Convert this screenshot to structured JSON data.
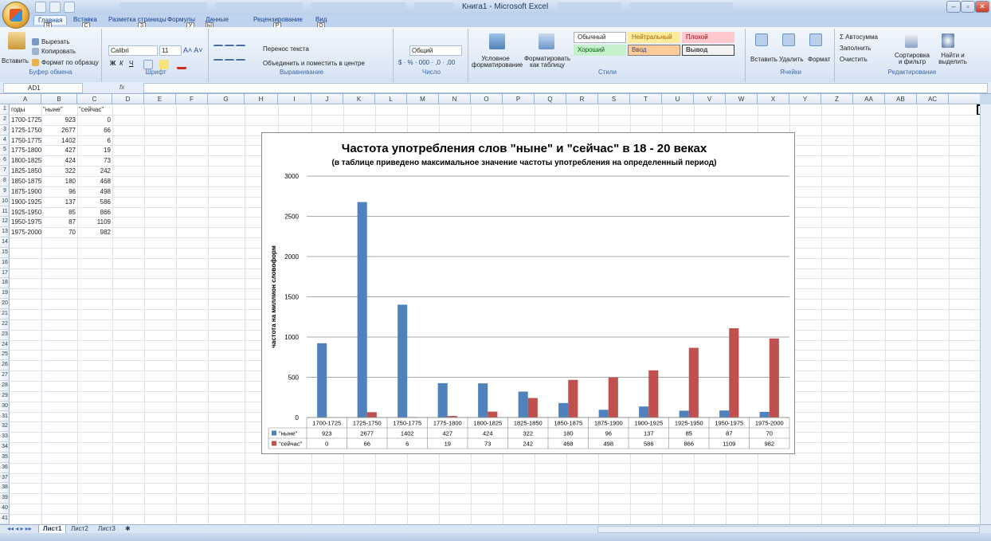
{
  "window": {
    "title": "Книга1 - Microsoft Excel",
    "controls": [
      "–",
      "▫",
      "✕"
    ]
  },
  "ribbon": {
    "tabs": [
      "Главная",
      "Вставка",
      "Разметка страницы",
      "Формулы",
      "Данные",
      "Рецензирование",
      "Вид"
    ],
    "keytips": [
      "Я",
      "С",
      "З",
      "У",
      "Ы",
      "Р",
      "О"
    ],
    "clipboard": {
      "paste": "Вставить",
      "cut": "Вырезать",
      "copy": "Копировать",
      "format_painter": "Формат по образцу",
      "label": "Буфер обмена"
    },
    "font": {
      "name": "Calibri",
      "size": "11",
      "bold": "Ж",
      "italic": "К",
      "underline": "Ч",
      "label": "Шрифт"
    },
    "alignment": {
      "wrap": "Перенос текста",
      "merge": "Объединить и поместить в центре",
      "label": "Выравнивание"
    },
    "number": {
      "format": "Общий",
      "label": "Число"
    },
    "styles": {
      "conditional": "Условное форматирование",
      "as_table": "Форматировать как таблицу",
      "normal": "Обычный",
      "neutral": "Нейтральный",
      "bad": "Плохой",
      "good": "Хороший",
      "input": "Ввод",
      "output": "Вывод",
      "label": "Стили"
    },
    "cells": {
      "insert": "Вставить",
      "delete": "Удалить",
      "format": "Формат",
      "label": "Ячейки"
    },
    "editing": {
      "autosum": "Автосумма",
      "fill": "Заполнить",
      "clear": "Очистить",
      "sort": "Сортировка и фильтр",
      "find": "Найти и выделить",
      "label": "Редактирование"
    }
  },
  "formula_bar": {
    "name_box": "AD1",
    "fx": "fx",
    "value": ""
  },
  "columns": [
    "A",
    "B",
    "C",
    "D",
    "E",
    "F",
    "G",
    "H",
    "I",
    "J",
    "K",
    "L",
    "M",
    "N",
    "O",
    "P",
    "Q",
    "R",
    "S",
    "T",
    "U",
    "V",
    "W",
    "X",
    "Y",
    "Z",
    "AA",
    "AB",
    "AC"
  ],
  "rows": [
    "1",
    "2",
    "3",
    "4",
    "5",
    "6",
    "7",
    "8",
    "9",
    "10",
    "11",
    "12",
    "13",
    "14",
    "15",
    "16",
    "17",
    "18",
    "19",
    "20",
    "21",
    "22",
    "23",
    "24",
    "25",
    "26",
    "27",
    "28",
    "29",
    "30",
    "31",
    "32",
    "33",
    "34",
    "35",
    "36",
    "37",
    "38",
    "39",
    "40",
    "41"
  ],
  "sheet": {
    "header": [
      "годы",
      "\"ныне\"",
      "\"сейчас\""
    ],
    "data": [
      [
        "1700-1725",
        "923",
        "0"
      ],
      [
        "1725-1750",
        "2677",
        "66"
      ],
      [
        "1750-1775",
        "1402",
        "6"
      ],
      [
        "1775-1800",
        "427",
        "19"
      ],
      [
        "1800-1825",
        "424",
        "73"
      ],
      [
        "1825-1850",
        "322",
        "242"
      ],
      [
        "1850-1875",
        "180",
        "468"
      ],
      [
        "1875-1900",
        "96",
        "498"
      ],
      [
        "1900-1925",
        "137",
        "586"
      ],
      [
        "1925-1950",
        "85",
        "866"
      ],
      [
        "1950-1975",
        "87",
        "1109"
      ],
      [
        "1975-2000",
        "70",
        "982"
      ]
    ]
  },
  "sheet_tabs": [
    "Лист1",
    "Лист2",
    "Лист3"
  ],
  "colors": {
    "series1": "#4f81bd",
    "series2": "#c0504d"
  },
  "chart_data": {
    "type": "bar",
    "title": "Частота употребления слов \"ныне\" и \"сейчас\" в 18 - 20 веках",
    "subtitle": "(в таблице приведено максимальное значение частоты употребления на определенный период)",
    "ylabel": "частота на миллион словоформ",
    "xlabel": "",
    "ylim": [
      0,
      3000
    ],
    "yticks": [
      "0",
      "500",
      "1000",
      "1500",
      "2000",
      "2500",
      "3000"
    ],
    "grid": true,
    "legend": "data-table",
    "categories": [
      "1700-1725",
      "1725-1750",
      "1750-1775",
      "1775-1800",
      "1800-1825",
      "1825-1850",
      "1850-1875",
      "1875-1900",
      "1900-1925",
      "1925-1950",
      "1950-1975",
      "1975-2000"
    ],
    "series": [
      {
        "name": "\"ныне\"",
        "values": [
          923,
          2677,
          1402,
          427,
          424,
          322,
          180,
          96,
          137,
          85,
          87,
          70
        ]
      },
      {
        "name": "\"сейчас\"",
        "values": [
          0,
          66,
          6,
          19,
          73,
          242,
          468,
          498,
          586,
          866,
          1109,
          982
        ]
      }
    ]
  }
}
